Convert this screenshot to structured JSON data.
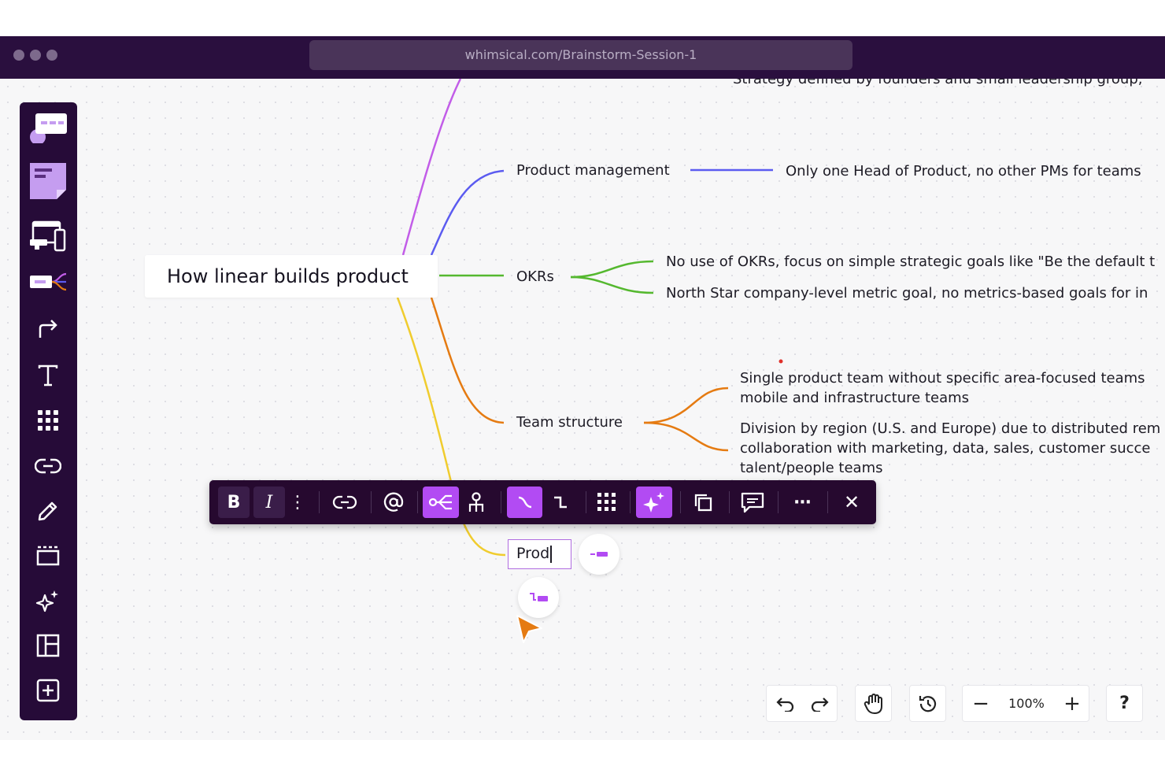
{
  "browser": {
    "url": "whimsical.com/Brainstorm-Session-1"
  },
  "sidebar": {
    "tools": [
      {
        "icon": "sticky-comment-icon"
      },
      {
        "icon": "sticky-note-icon"
      },
      {
        "icon": "wireframe-devices-icon"
      },
      {
        "icon": "mind-map-icon"
      },
      {
        "icon": "connector-arrow-icon"
      },
      {
        "icon": "text-icon"
      },
      {
        "icon": "grid-dots-icon"
      },
      {
        "icon": "link-icon"
      },
      {
        "icon": "pencil-icon"
      },
      {
        "icon": "frame-icon"
      },
      {
        "icon": "ai-sparkle-icon"
      },
      {
        "icon": "layout-template-icon"
      },
      {
        "icon": "add-square-icon"
      }
    ]
  },
  "mindmap": {
    "root": "How linear builds product",
    "top_cut_text": "Strategy defined by founders and small leadership group,",
    "branches": [
      {
        "label": "Product management",
        "color": "#5b5bf0",
        "leaves": [
          "Only one Head of Product, no other PMs for teams"
        ]
      },
      {
        "label": "OKRs",
        "color": "#55b82f",
        "leaves": [
          "No use of OKRs, focus on simple strategic goals like \"Be the default t",
          "North Star company-level metric goal, no metrics-based goals for in"
        ]
      },
      {
        "label": "Team structure",
        "color": "#e57b12",
        "leaves": [
          [
            "Single product team without specific area-focused teams",
            "mobile and infrastructure teams"
          ],
          [
            "Division by region (U.S. and Europe) due to distributed rem",
            "collaboration with marketing, data, sales, customer succe",
            "talent/people teams"
          ]
        ]
      }
    ],
    "editing_node_text": "Prod",
    "top_branch_color": "#c25de8",
    "new_branch_color": "#f0cc2e"
  },
  "toolbar": {
    "bold_label": "B",
    "italic_label": "I",
    "more_label": "⋮",
    "ellipsis_label": "···",
    "close_label": "✕",
    "accent": "#b24bf3"
  },
  "controls": {
    "zoom": "100%",
    "help_label": "?",
    "minus_label": "−",
    "plus_label": "+"
  },
  "colors": {
    "topbar": "#2a0f3e",
    "sidebar": "#260b38",
    "cursor": "#e57b12"
  }
}
